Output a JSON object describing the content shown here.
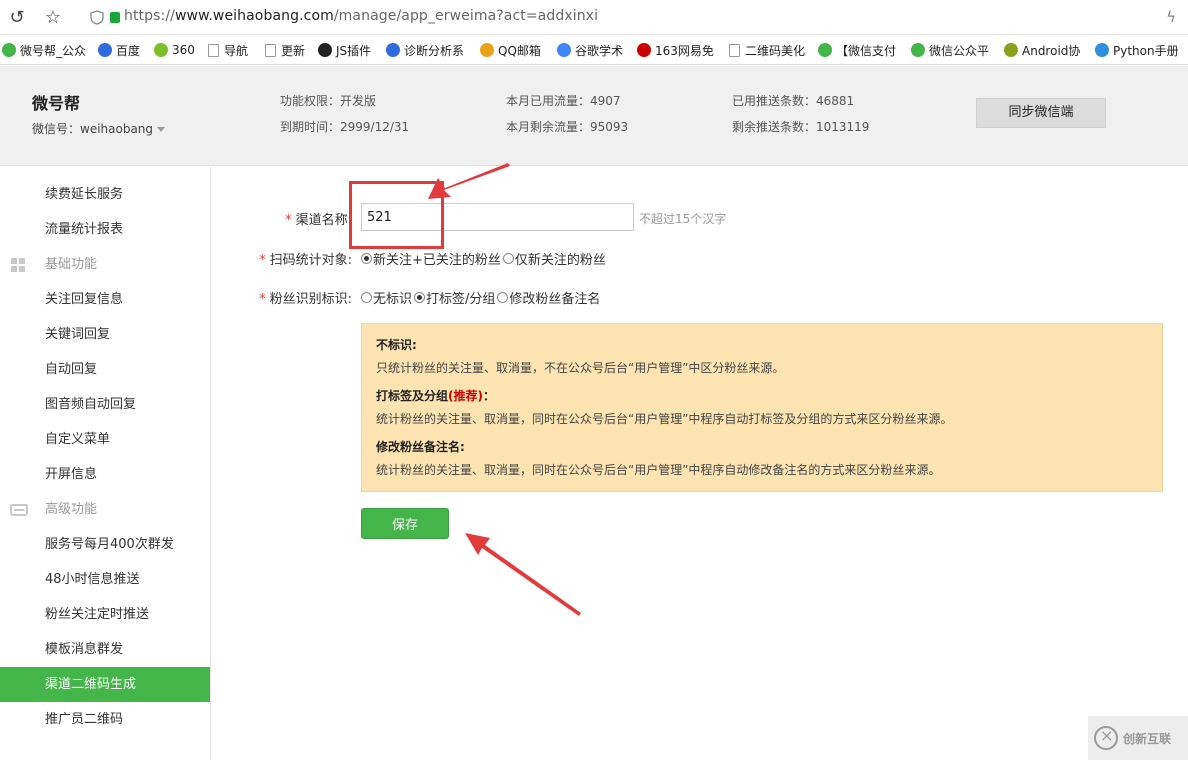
{
  "browser": {
    "url_prefix": "https://",
    "url_host": "www.weihaobang.com",
    "url_path": "/manage/app_erweima?act=addxinxi",
    "back_icon": "refresh-icon",
    "star_icon": "star-icon"
  },
  "bookmarks": [
    {
      "label": "微号帮_公众",
      "icon": "wechat-icon",
      "color": "#44b549"
    },
    {
      "label": "百度",
      "icon": "baidu-icon",
      "color": "#2f6bdc"
    },
    {
      "label": "360",
      "icon": "360-icon",
      "color": "#7dbf2b"
    },
    {
      "label": "导航",
      "icon": "doc-icon",
      "color": ""
    },
    {
      "label": "更新",
      "icon": "doc-icon",
      "color": ""
    },
    {
      "label": "JS插件",
      "icon": "js-icon",
      "color": "#222"
    },
    {
      "label": "诊断分析系",
      "icon": "diag-icon",
      "color": "#2f6bdc"
    },
    {
      "label": "QQ邮箱",
      "icon": "chrome-icon",
      "color": "#e8a317"
    },
    {
      "label": "谷歌学术",
      "icon": "google-icon",
      "color": "#4285f4"
    },
    {
      "label": "163网易免",
      "icon": "163-icon",
      "color": "#c00"
    },
    {
      "label": "二维码美化",
      "icon": "doc-icon",
      "color": ""
    },
    {
      "label": "【微信支付",
      "icon": "wechat-icon",
      "color": "#44b549"
    },
    {
      "label": "微信公众平",
      "icon": "wechat-icon",
      "color": "#44b549"
    },
    {
      "label": "Android协",
      "icon": "android-icon",
      "color": "#8aa01c"
    },
    {
      "label": "Python手册",
      "icon": "python-icon",
      "color": "#2f8fdc"
    }
  ],
  "header": {
    "brand": "微号帮",
    "wechat_id": "微信号：weihaobang",
    "stats": {
      "permission": "功能权限：开发版",
      "expire": "到期时间：2999/12/31",
      "used_traffic": "本月已用流量：4907",
      "remaining_traffic": "本月剩余流量：95093",
      "pushed": "已用推送条数：46881",
      "remaining_push": "剩余推送条数：1013119"
    },
    "sync_button": "同步微信端"
  },
  "sidebar": {
    "items": [
      {
        "label": "续费延长服务",
        "type": "item"
      },
      {
        "label": "流量统计报表",
        "type": "item"
      },
      {
        "label": "基础功能",
        "type": "group",
        "icon": "grid-icon"
      },
      {
        "label": "关注回复信息",
        "type": "item"
      },
      {
        "label": "关键词回复",
        "type": "item"
      },
      {
        "label": "自动回复",
        "type": "item"
      },
      {
        "label": "图音频自动回复",
        "type": "item"
      },
      {
        "label": "自定义菜单",
        "type": "item"
      },
      {
        "label": "开屏信息",
        "type": "item"
      },
      {
        "label": "高级功能",
        "type": "group",
        "icon": "inbox-icon"
      },
      {
        "label": "服务号每月400次群发",
        "type": "item"
      },
      {
        "label": "48小时信息推送",
        "type": "item"
      },
      {
        "label": "粉丝关注定时推送",
        "type": "item"
      },
      {
        "label": "模板消息群发",
        "type": "item"
      },
      {
        "label": "渠道二维码生成",
        "type": "item",
        "active": true
      },
      {
        "label": "推广员二维码",
        "type": "item"
      }
    ]
  },
  "form": {
    "required_mark": "*",
    "channel_name_label": "渠道名称:",
    "channel_name_value": "521",
    "channel_name_hint": "不超过15个汉字",
    "scan_target_label": "扫码统计对象:",
    "scan_target_options": [
      {
        "label": "新关注+已关注的粉丝",
        "checked": true
      },
      {
        "label": "仅新关注的粉丝",
        "checked": false
      }
    ],
    "fan_mark_label": "粉丝识别标识:",
    "fan_mark_options": [
      {
        "label": "无标识",
        "checked": false
      },
      {
        "label": "打标签/分组",
        "checked": true
      },
      {
        "label": "修改粉丝备注名",
        "checked": false
      }
    ],
    "save_button": "保存"
  },
  "info": {
    "title1": "不标识:",
    "text1": "只统计粉丝的关注量、取消量，不在公众号后台“用户管理”中区分粉丝来源。",
    "title2": "打标签及分组",
    "title2_recommend": "(推荐)",
    "title2_suffix": "：",
    "text2": "统计粉丝的关注量、取消量，同时在公众号后台“用户管理”中程序自动打标签及分组的方式来区分粉丝来源。",
    "title3": "修改粉丝备注名:",
    "text3": "统计粉丝的关注量、取消量，同时在公众号后台“用户管理”中程序自动修改备注名的方式来区分粉丝来源。"
  },
  "watermark": {
    "text": "创新互联",
    "sub": "CHUANG XIN HU LIAN"
  },
  "colors": {
    "accent_green": "#44b549",
    "annotation_red": "#e23b3b",
    "info_bg": "#fce4b2"
  }
}
